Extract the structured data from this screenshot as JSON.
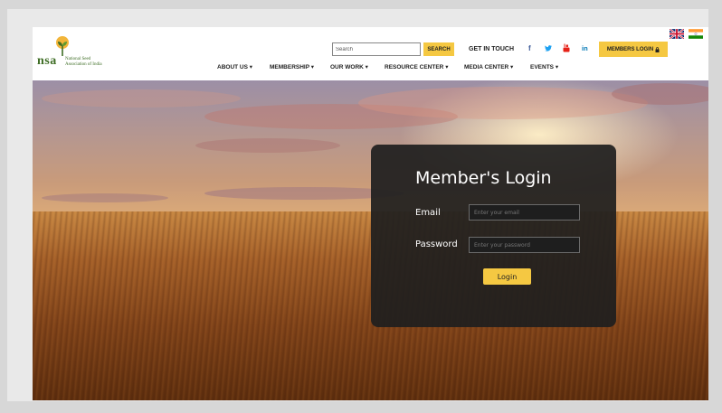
{
  "brand": {
    "abbr": "nsa",
    "full_name_line1": "National Seed",
    "full_name_line2": "Association of India"
  },
  "search": {
    "placeholder": "Search",
    "button_label": "SEARCH"
  },
  "header": {
    "get_in_touch": "GET IN TOUCH",
    "social_icons": [
      "facebook-icon",
      "twitter-icon",
      "youtube-icon",
      "linkedin-icon"
    ],
    "members_login": "MEMBERS LOGIN",
    "flags": [
      "uk-flag",
      "india-flag"
    ]
  },
  "nav": {
    "items": [
      {
        "label": "ABOUT US"
      },
      {
        "label": "MEMBERSHIP"
      },
      {
        "label": "OUR WORK"
      },
      {
        "label": "RESOURCE CENTER"
      },
      {
        "label": "MEDIA CENTER"
      },
      {
        "label": "EVENTS"
      }
    ]
  },
  "login": {
    "title": "Member's Login",
    "email_label": "Email",
    "email_placeholder": "Enter your email",
    "password_label": "Password",
    "password_placeholder": "Enter your password",
    "button_label": "Login"
  },
  "colors": {
    "accent": "#f5c842",
    "brand_green": "#3f6e26",
    "panel": "#1e1e1e"
  }
}
